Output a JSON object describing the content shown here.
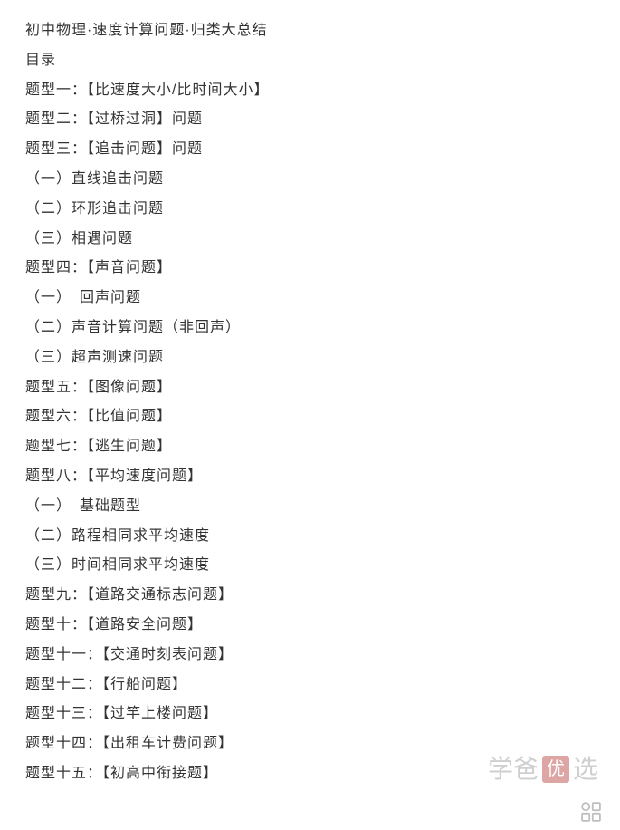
{
  "title": "初中物理·速度计算问题·归类大总结",
  "toc_label": "目录",
  "lines": [
    "题型一：【比速度大小/比时间大小】",
    "题型二：【过桥过洞】问题",
    "题型三：【追击问题】问题",
    "（一）直线追击问题",
    "（二）环形追击问题",
    "（三）相遇问题",
    "题型四：【声音问题】",
    "（一）　回声问题",
    "（二）声音计算问题（非回声）",
    "（三）超声测速问题",
    "题型五：【图像问题】",
    "题型六：【比值问题】",
    "题型七：【逃生问题】",
    "题型八：【平均速度问题】",
    "（一）　基础题型",
    "（二）路程相同求平均速度",
    "（三）时间相同求平均速度",
    "题型九：【道路交通标志问题】",
    "题型十：【道路安全问题】",
    "题型十一：【交通时刻表问题】",
    "题型十二：【行船问题】",
    "题型十三：【过竿上楼问题】",
    "题型十四：【出租车计费问题】",
    "题型十五：【初高中衔接题】"
  ],
  "watermark": {
    "part1": "学爸",
    "seal": "优",
    "part2": "选"
  }
}
